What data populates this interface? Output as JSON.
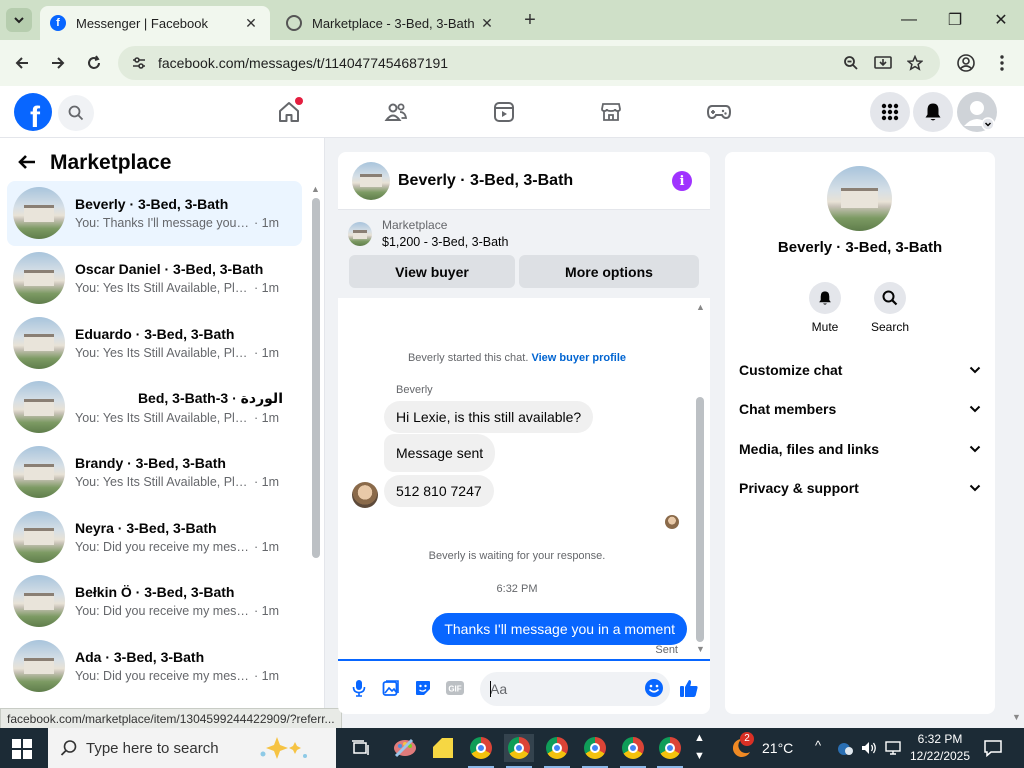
{
  "browser": {
    "tabs": [
      {
        "title": "Messenger | Facebook",
        "active": true
      },
      {
        "title": "Marketplace - 3-Bed, 3-Bath | Fa",
        "active": false
      }
    ],
    "url": "facebook.com/messages/t/1140477454687191",
    "status_url": "facebook.com/marketplace/item/1304599244422909/?referr..."
  },
  "left": {
    "title": "Marketplace",
    "conversations": [
      {
        "name": "Beverly · 3-Bed, 3-Bath",
        "preview": "You: Thanks I'll message you in a ...",
        "time": "· 1m",
        "selected": true
      },
      {
        "name": "Oscar Daniel · 3-Bed, 3-Bath",
        "preview": "You: Yes Its Still Available, Please S...",
        "time": "· 1m"
      },
      {
        "name": "Eduardo · 3-Bed, 3-Bath",
        "preview": "You: Yes Its Still Available, Please S...",
        "time": "· 1m"
      },
      {
        "name": "الوردة · 3-Bed, 3-Bath",
        "preview": "You: Yes Its Still Available, Please S...",
        "time": "· 1m",
        "rtl": true
      },
      {
        "name": "Brandy · 3-Bed, 3-Bath",
        "preview": "You: Yes Its Still Available, Please S...",
        "time": "· 1m"
      },
      {
        "name": "Neyra · 3-Bed, 3-Bath",
        "preview": "You: Did you receive my message",
        "time": "· 1m"
      },
      {
        "name": "Bełkin Ö · 3-Bed, 3-Bath",
        "preview": "You: Did you receive my message",
        "time": "· 1m"
      },
      {
        "name": "Ada · 3-Bed, 3-Bath",
        "preview": "You: Did you receive my message",
        "time": "· 1m"
      }
    ]
  },
  "chat": {
    "header_name": "Beverly · 3-Bed, 3-Bath",
    "listing_label": "Marketplace",
    "listing_price": "$1,200 - 3-Bed, 3-Bath",
    "view_buyer": "View buyer",
    "more_options": "More options",
    "started_text": "Beverly started this chat.",
    "view_buyer_profile": "View buyer profile",
    "sender": "Beverly",
    "messages_in": [
      "Hi Lexie, is this still available?",
      "Message sent",
      "512 810 7247"
    ],
    "waiting_text": "Beverly is waiting for your response.",
    "timestamp": "6:32 PM",
    "message_out": "Thanks I'll message you in a moment",
    "sent_label": "Sent",
    "input_placeholder": "Aa"
  },
  "right": {
    "name": "Beverly · 3-Bed, 3-Bath",
    "mute": "Mute",
    "search": "Search",
    "sections": [
      "Customize chat",
      "Chat members",
      "Media, files and links",
      "Privacy & support"
    ]
  },
  "taskbar": {
    "search_placeholder": "Type here to search",
    "weather": "21°C",
    "weather_badge": "2",
    "time": "6:32 PM",
    "date": "12/22/2025"
  },
  "colors": {
    "fb_blue": "#0866ff",
    "accent_purple": "#a033ff",
    "notif_red": "#e41e3f"
  }
}
